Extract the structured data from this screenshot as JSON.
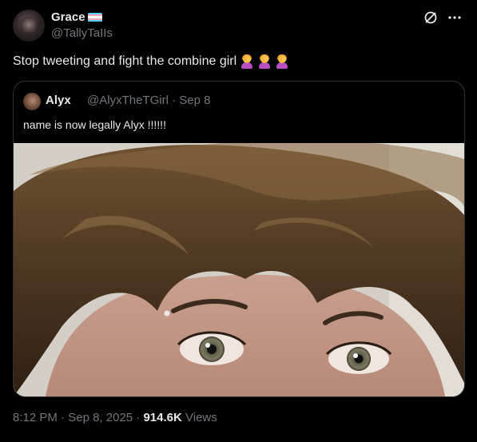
{
  "author": {
    "display_name": "Grace",
    "handle": "@TallyTaIIs",
    "flag": "transgender-flag",
    "flag_colors": [
      "#5bcefa",
      "#f5a9b8",
      "#ffffff",
      "#f5a9b8",
      "#5bcefa"
    ]
  },
  "tweet": {
    "text": "Stop tweeting and fight the combine girl",
    "emojis": [
      "woman-facepalming",
      "woman-facepalming",
      "woman-facepalming"
    ]
  },
  "quote": {
    "display_name": "Alyx",
    "handle": "@AlyxTheTGirl",
    "separator": "·",
    "date": "Sep 8",
    "text": "name is now legally Alyx !!!!!!",
    "media": "photo"
  },
  "footer": {
    "time": "8:12 PM",
    "separator": "·",
    "date": "Sep 8, 2025",
    "separator2": "·",
    "views_count": "914.6K",
    "views_label": "Views"
  },
  "actions": {
    "grok_icon": "slash-circle-icon",
    "more_icon": "more-icon"
  },
  "colors": {
    "background": "#000000",
    "text": "#e7e9ea",
    "secondary": "#71767b",
    "border": "#2f3336"
  }
}
